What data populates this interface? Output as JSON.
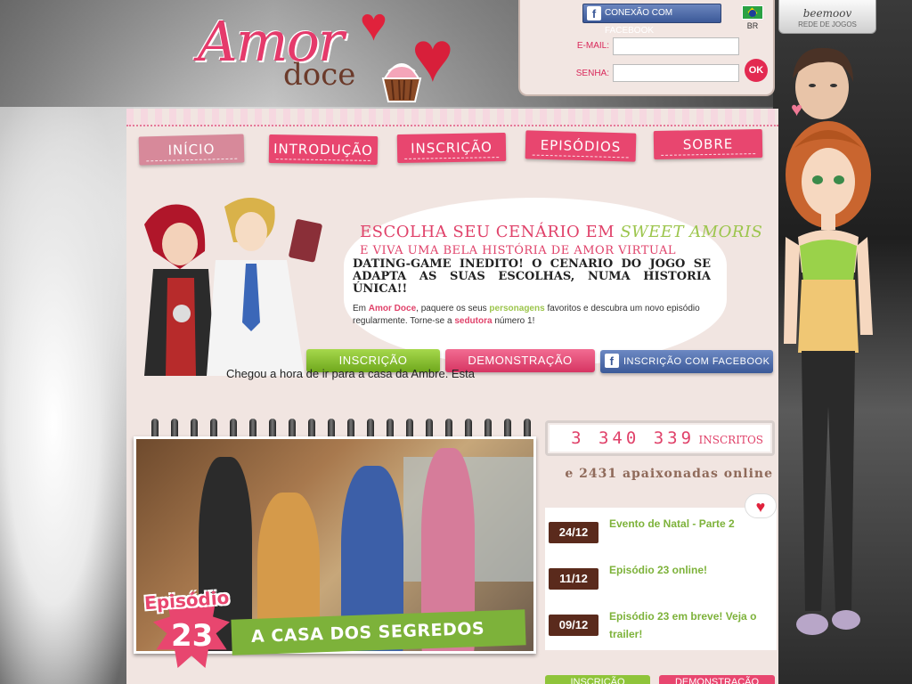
{
  "header": {
    "logo_main": "Amor",
    "logo_sub": "doce",
    "login": {
      "fb_button": "CONEXÃO COM FACEBOOK",
      "email_label": "E-MAIL:",
      "password_label": "SENHA:",
      "ok_label": "OK"
    },
    "language": "BR",
    "network": {
      "brand": "beemoov",
      "subtitle": "REDE DE JOGOS"
    }
  },
  "nav": {
    "items": [
      {
        "label": "Início",
        "active": true
      },
      {
        "label": "Introdução",
        "active": false
      },
      {
        "label": "Inscrição",
        "active": false
      },
      {
        "label": "Episódios",
        "active": false
      },
      {
        "label": "Sobre",
        "active": false
      }
    ]
  },
  "hero": {
    "title_prefix": "ESCOLHA SEU CENÁRIO EM ",
    "title_highlight": "SWEET AMORIS",
    "subtitle": "E VIVA UMA BELA HISTÓRIA DE AMOR VIRTUAL",
    "strong": "DATING-GAME INEDITO! O CENARIO DO JOGO SE ADAPTA AS SUAS ESCOLHAS, NUMA HISTORIA ÚNICA!!",
    "body": {
      "p1": "Em ",
      "brand": "Amor Doce",
      "p2": ", paquere os seus ",
      "characters": "personagens",
      "p3": " favoritos e descubra um novo episódio regularmente. Torne-se a ",
      "seductress": "sedutora",
      "p4": " número 1!"
    },
    "cta_signup": "INSCRIÇÃO",
    "cta_demo": "DEMONSTRAÇÃO",
    "cta_facebook": "INSCRIÇÃO COM FACEBOOK"
  },
  "episode": {
    "badge_word": "Episódio",
    "number": "23",
    "title": "A CASA DOS SEGREDOS",
    "description": "Chegou a hora de ir para a casa da Ambre. Esta"
  },
  "stats": {
    "subscribers": "3 340 339",
    "subscribers_label": "inscritos",
    "online": "e 2431 apaixonadas online"
  },
  "news": [
    {
      "date": "24/12",
      "text": "Evento de Natal - Parte 2"
    },
    {
      "date": "11/12",
      "text": "Episódio 23 online!"
    },
    {
      "date": "09/12",
      "text": "Episódio 23 em breve! Veja o trailer!"
    }
  ],
  "bottom_buttons": {
    "signup": "INSCRIÇÃO",
    "demo": "DEMONSTRAÇÃO"
  },
  "colors": {
    "brand_pink": "#e0426a",
    "brand_green": "#7db23a",
    "facebook_blue": "#3b5998",
    "date_brown": "#5a2a1c"
  }
}
